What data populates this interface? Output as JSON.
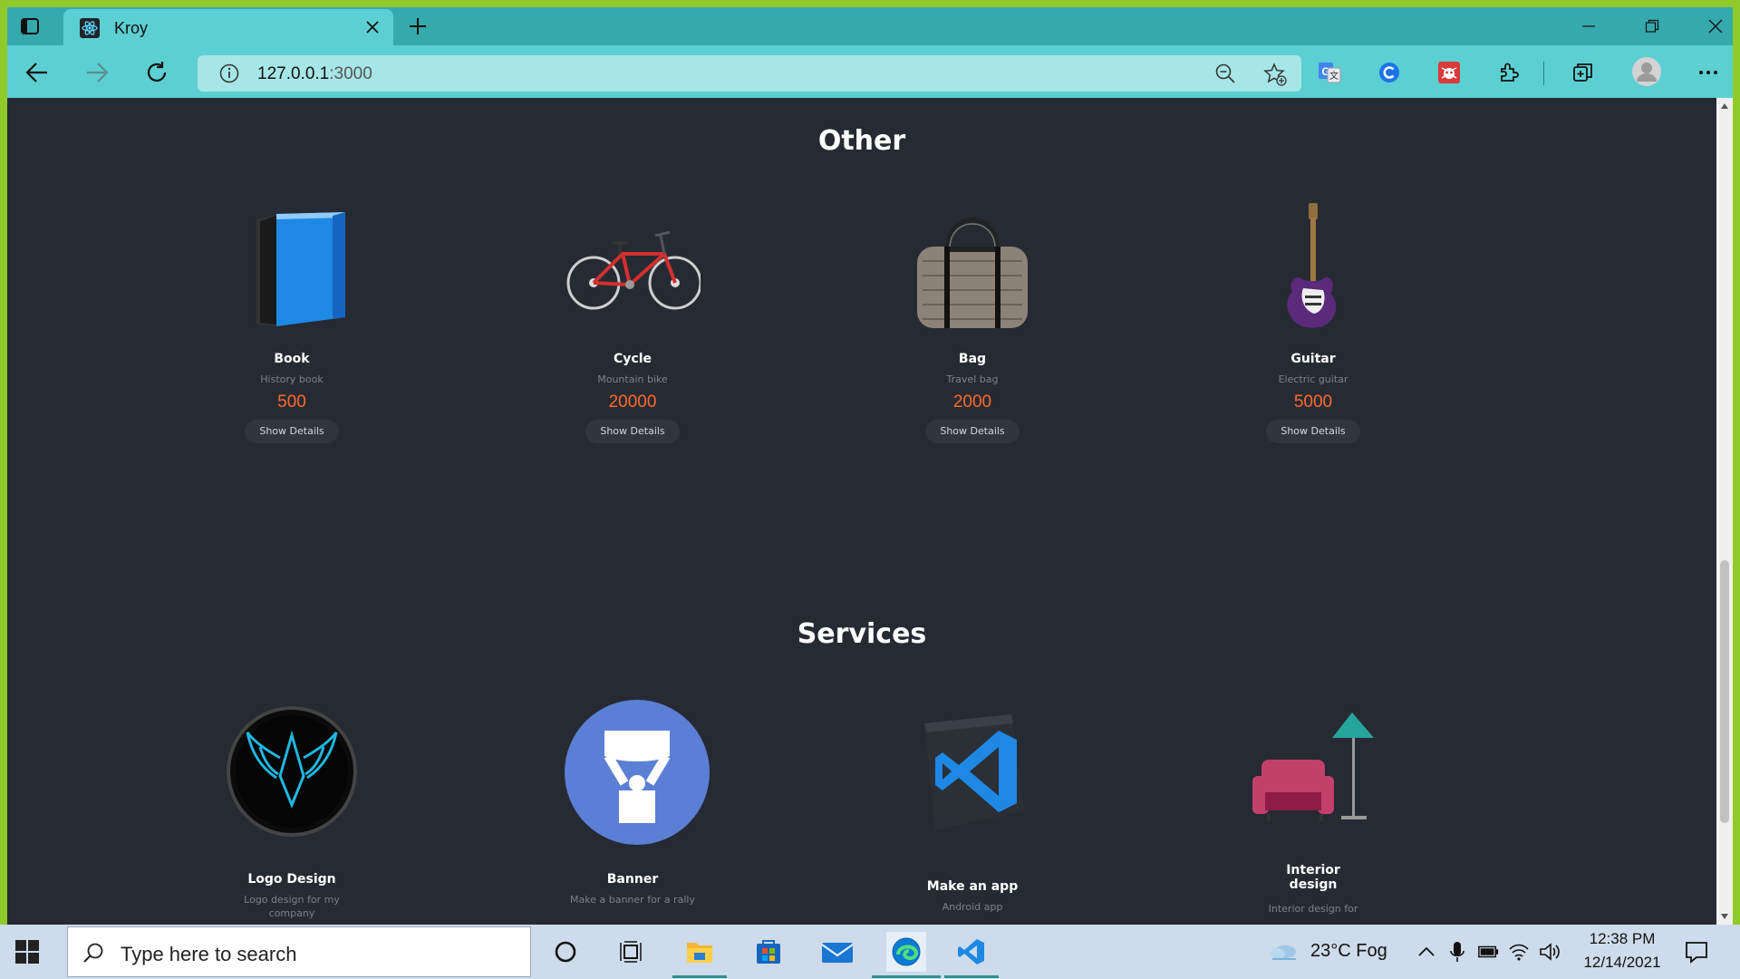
{
  "browser": {
    "tab_title": "Kroy",
    "url_host": "127.0.0.1",
    "url_port": ":3000"
  },
  "sections": {
    "other": {
      "title": "Other",
      "items": [
        {
          "name": "Book",
          "desc": "History book",
          "price": "500",
          "button": "Show Details"
        },
        {
          "name": "Cycle",
          "desc": "Mountain bike",
          "price": "20000",
          "button": "Show Details"
        },
        {
          "name": "Bag",
          "desc": "Travel bag",
          "price": "2000",
          "button": "Show Details"
        },
        {
          "name": "Guitar",
          "desc": "Electric guitar",
          "price": "5000",
          "button": "Show Details"
        }
      ]
    },
    "services": {
      "title": "Services",
      "items": [
        {
          "name": "Logo Design",
          "desc": "Logo design for my company"
        },
        {
          "name": "Banner",
          "desc": "Make a banner for a rally"
        },
        {
          "name": "Make an app",
          "desc": "Android app"
        },
        {
          "name": "Interior design",
          "desc": "Interior design for"
        }
      ]
    }
  },
  "taskbar": {
    "search_placeholder": "Type here to search",
    "weather": "23°C  Fog",
    "time": "12:38 PM",
    "date": "12/14/2021"
  },
  "colors": {
    "accent_price": "#ff6a2a",
    "page_bg": "#262a33",
    "browser_teal": "#5ccfd2"
  }
}
